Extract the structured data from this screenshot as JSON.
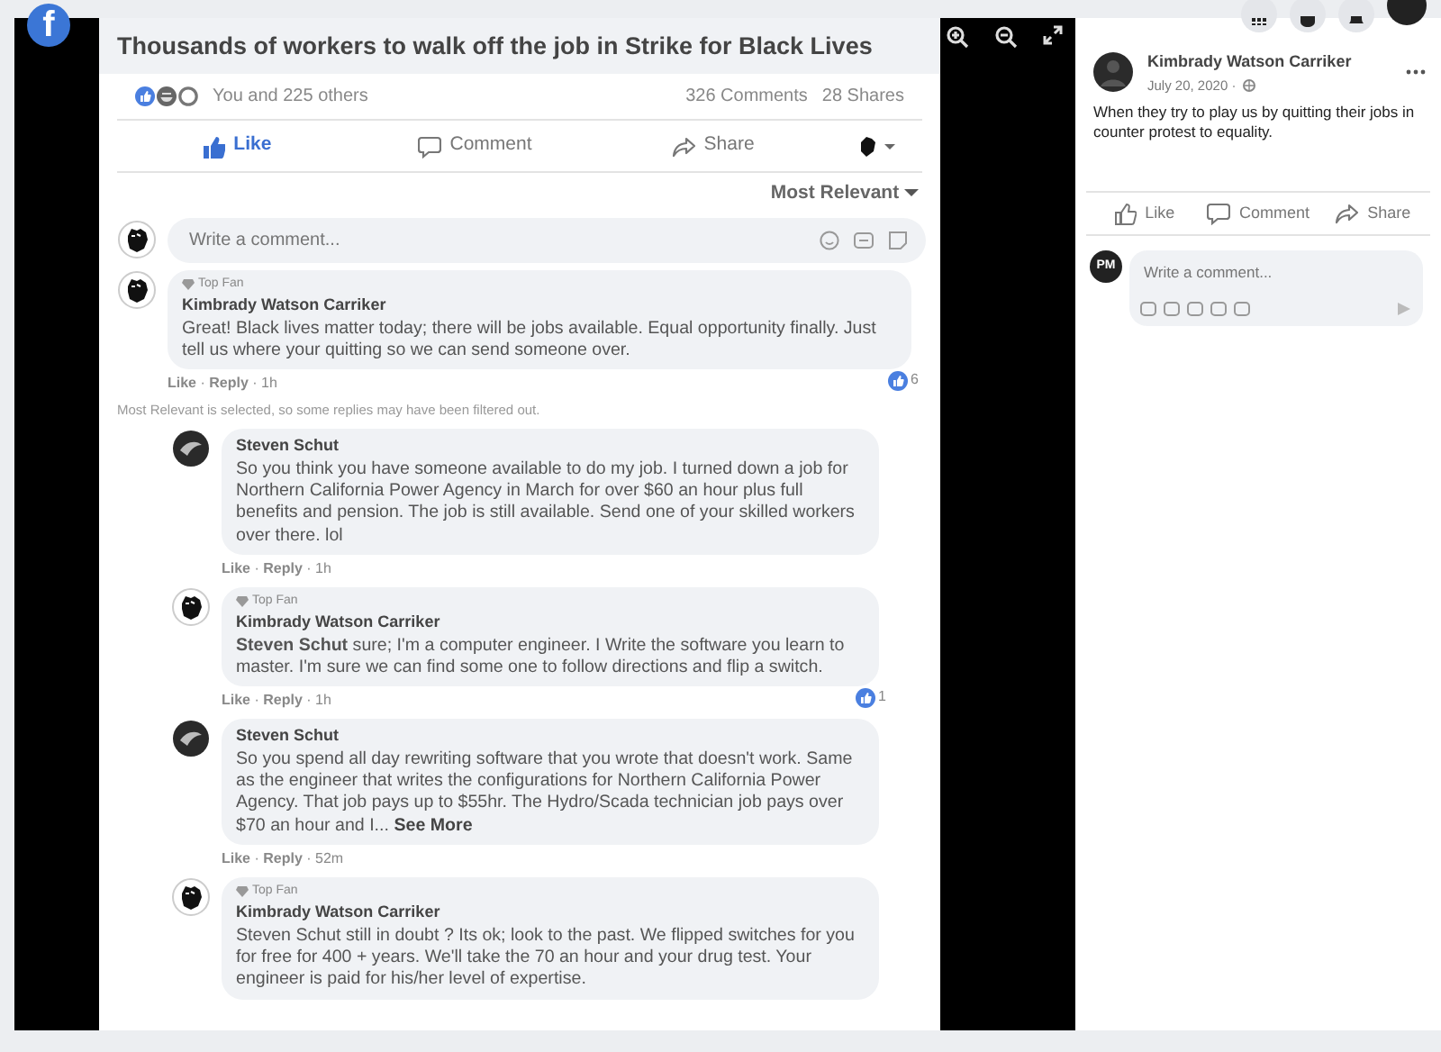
{
  "viewer": {
    "logo": "f",
    "post_title": "Thousands of workers to walk off the job in Strike for Black Lives"
  },
  "post_stats": {
    "reactions_text": "You and 225 others",
    "comments": "326 Comments",
    "shares": "28 Shares"
  },
  "post_actions": [
    {
      "kind": "like",
      "label": "Like",
      "selected": true
    },
    {
      "kind": "comment",
      "label": "Comment",
      "selected": false
    },
    {
      "kind": "share",
      "label": "Share",
      "selected": false
    }
  ],
  "sort": {
    "label": "Most Relevant"
  },
  "composer": {
    "placeholder": "Write a comment..."
  },
  "separator": " · ",
  "comments": [
    {
      "author": "Kimbrady Watson Carriker",
      "top_fan": "Top Fan",
      "text": "Great! Black lives matter today; there will be jobs available. Equal opportunity finally. Just tell us where your quitting so we can send someone over.",
      "reactions": "6",
      "like": "Like",
      "reply": "Reply",
      "time": "1h",
      "filter_note": "Most Relevant is selected, so some replies may have been filtered out.",
      "children": [
        {
          "author": "Steven Schut",
          "text": "So you think you have someone available to do my job. I turned down a job for Northern California Power Agency in March for over $60 an hour plus full benefits and pension. The job is still available. Send one of your skilled workers over there. lol",
          "like": "Like",
          "reply": "Reply",
          "time": "1h"
        },
        {
          "author": "Kimbrady Watson Carriker",
          "top_fan": "Top Fan",
          "text": "**Steven Schut** sure; I'm a computer engineer. I Write the software you learn to master. I'm sure we can find some one to follow directions and flip a switch.",
          "reactions": "1",
          "like": "Like",
          "reply": "Reply",
          "time": "1h"
        },
        {
          "author": "Steven Schut",
          "text": "So you spend all day rewriting software that you wrote that doesn't work. Same as the engineer that writes the configurations for Northern California Power Agency. That job pays up to $55hr. The Hydro/Scada technician job pays over $70 an hour and I...",
          "see_more": "See More",
          "like": "Like",
          "reply": "Reply",
          "time": "52m"
        },
        {
          "author": "Kimbrady Watson Carriker",
          "top_fan": "Top Fan",
          "text": "Steven Schut still in doubt ? Its ok; look to the past. We flipped switches for you for free for 400 + years. We'll take the 70 an hour and your drug test. Your engineer is paid for his/her level of expertise."
        }
      ]
    }
  ],
  "side_post": {
    "author": "Kimbrady Watson Carriker",
    "date": "July 20, 2020 ·",
    "text": "When they try to play us by quitting their jobs in counter protest to equality.",
    "actions": [
      {
        "kind": "like",
        "label": "Like",
        "selected": false
      },
      {
        "kind": "comment",
        "label": "Comment",
        "selected": false
      },
      {
        "kind": "share",
        "label": "Share",
        "selected": false
      }
    ],
    "user_initials": "PM",
    "composer": {
      "placeholder": "Write a comment..."
    }
  }
}
